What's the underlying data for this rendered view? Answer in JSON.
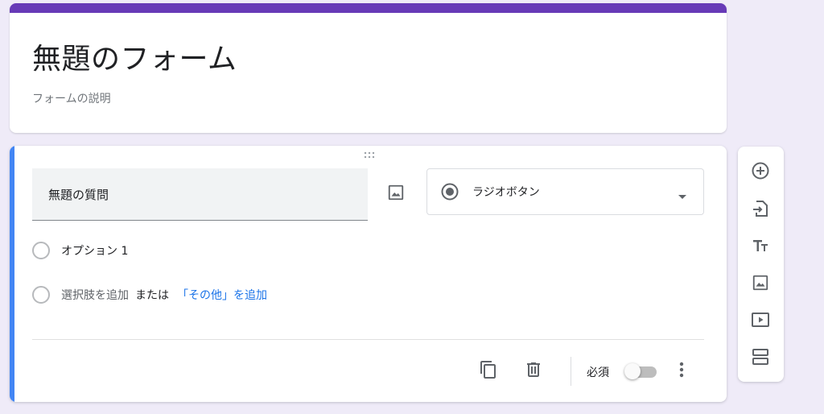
{
  "form": {
    "title": "無題のフォーム",
    "description": "フォームの説明"
  },
  "question": {
    "title": "無題の質問",
    "type_label": "ラジオボタン",
    "option_1": "オプション 1",
    "add_option": "選択肢を追加",
    "or": "または",
    "add_other": "「その他」を追加",
    "required_label": "必須",
    "required": false
  },
  "colors": {
    "accent": "#673ab7",
    "active_bar": "#4285f4",
    "link": "#1a73e8",
    "background": "#efebf8"
  },
  "icons": {
    "question_image": "image-icon",
    "type": "radio-button-icon",
    "dropdown": "arrow-drop-down-icon",
    "copy": "content-copy-icon",
    "delete": "trash-icon",
    "more": "more-vert-icon",
    "add_question": "add-circle-icon",
    "import": "import-questions-icon",
    "title": "title-text-icon",
    "image": "image-icon",
    "video": "video-icon",
    "section": "section-icon"
  }
}
